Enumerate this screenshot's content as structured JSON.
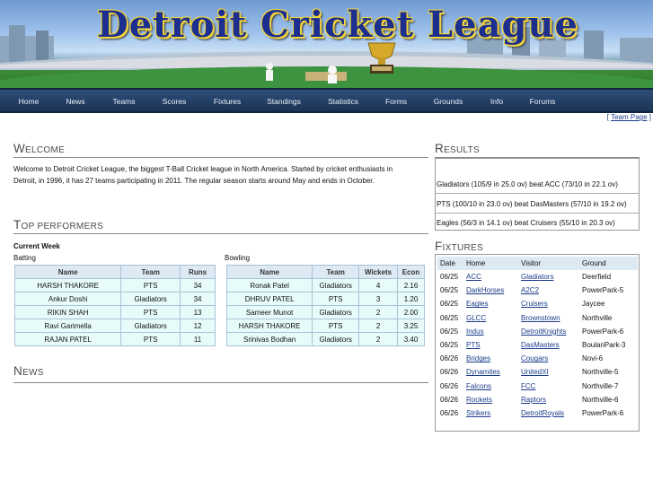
{
  "banner": {
    "title": "Detroit Cricket League"
  },
  "nav": [
    "Home",
    "News",
    "Teams",
    "Scores",
    "Fixtures",
    "Standings",
    "Statistics",
    "Forms",
    "Grounds",
    "Info",
    "Forums"
  ],
  "team_page_link": "Team Page",
  "welcome": {
    "heading": "Welcome",
    "text": "Welcome to Detroit Cricket League, the biggest T-Ball Cricket league in North America. Started by cricket enthusiasts in Detroit, in 1996, it has 27 teams participating in 2011. The regular season starts around May and ends in October."
  },
  "top_performers": {
    "heading": "Top Performers",
    "period": "Current Week",
    "batting": {
      "label": "Batting",
      "columns": [
        "Name",
        "Team",
        "Runs"
      ],
      "rows": [
        [
          "HARSH THAKORE",
          "PTS",
          "34"
        ],
        [
          "Ankur Doshi",
          "Gladiators",
          "34"
        ],
        [
          "RIKIN SHAH",
          "PTS",
          "13"
        ],
        [
          "Ravi Garimella",
          "Gladiators",
          "12"
        ],
        [
          "RAJAN PATEL",
          "PTS",
          "11"
        ]
      ]
    },
    "bowling": {
      "label": "Bowling",
      "columns": [
        "Name",
        "Team",
        "Wickets",
        "Econ"
      ],
      "rows": [
        [
          "Ronak Patel",
          "Gladiators",
          "4",
          "2.16"
        ],
        [
          "DHRUV PATEL",
          "PTS",
          "3",
          "1.20"
        ],
        [
          "Sameer Munot",
          "Gladiators",
          "2",
          "2.00"
        ],
        [
          "HARSH THAKORE",
          "PTS",
          "2",
          "3.25"
        ],
        [
          "Srinivas Bodhan",
          "Gladiators",
          "2",
          "3.40"
        ]
      ]
    }
  },
  "news": {
    "heading": "News"
  },
  "results": {
    "heading": "Results",
    "items": [
      "Gladiators (105/9 in 25.0 ov) beat ACC (73/10 in 22.1 ov)",
      "PTS (100/10 in 23.0 ov) beat DasMasters (57/10 in 19.2 ov)",
      "Eagles (56/3 in 14.1 ov) beat Cruisers (55/10 in 20.3 ov)"
    ]
  },
  "fixtures": {
    "heading": "Fixtures",
    "columns": [
      "Date",
      "Home",
      "Visitor",
      "Ground"
    ],
    "rows": [
      [
        "06/25",
        "ACC",
        "Gladiators",
        "Deerfield"
      ],
      [
        "06/25",
        "DarkHorses",
        "A2C2",
        "PowerPark-5"
      ],
      [
        "06/25",
        "Eagles",
        "Cruisers",
        "Jaycee"
      ],
      [
        "06/25",
        "GLCC",
        "Brownstown",
        "Northville"
      ],
      [
        "06/25",
        "Indus",
        "DetroitKnights",
        "PowerPark-6"
      ],
      [
        "06/25",
        "PTS",
        "DasMasters",
        "BoulanPark-3"
      ],
      [
        "06/26",
        "Bridges",
        "Cougars",
        "Novi-6"
      ],
      [
        "06/26",
        "Dynamites",
        "UnitedXI",
        "Northville-5"
      ],
      [
        "06/26",
        "Falcons",
        "FCC",
        "Northville-7"
      ],
      [
        "06/26",
        "Rockets",
        "Raptors",
        "Northville-6"
      ],
      [
        "06/26",
        "Strikers",
        "DetroitRoyals",
        "PowerPark-6"
      ]
    ]
  },
  "colors": {
    "nav_bg": "#1f3a5f",
    "title_text": "#1c2f8f",
    "title_outline": "#f3d53a",
    "link": "#1a3c8a",
    "table_header": "#dde9f3",
    "table_cell": "#e8fbfb"
  }
}
